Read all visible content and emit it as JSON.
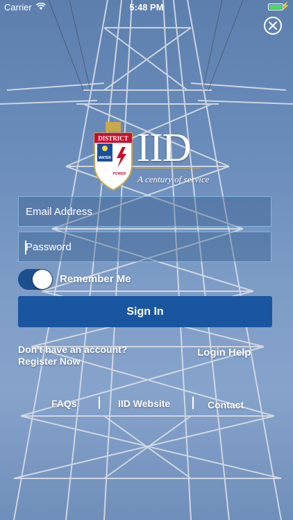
{
  "status_bar": {
    "carrier": "Carrier",
    "time": "5:48 PM",
    "battery_level": 1.0,
    "wifi_icon": "wifi-icon",
    "charging_icon": "bolt-icon"
  },
  "logo": {
    "district_text": "DISTRICT",
    "water_text": "WATER",
    "power_text": "POWER",
    "brand": "IID",
    "tagline": "A century of service"
  },
  "form": {
    "email_placeholder": "Email Address",
    "password_placeholder": "Password",
    "remember_label": "Remember Me",
    "remember_on": true,
    "signin_label": "Sign In"
  },
  "links": {
    "no_account": "Don't have an account?",
    "register": "Register Now",
    "login_help": "Login Help"
  },
  "footer": {
    "faqs": "FAQs",
    "website": "IID Website",
    "contact": "Contact"
  },
  "colors": {
    "sky": "#6b8dbb",
    "button": "#1a56a0",
    "toggle": "#1e4f8e",
    "field_border": "#8cbeeb",
    "battery": "#4cd964",
    "gold": "#c9a84a"
  }
}
